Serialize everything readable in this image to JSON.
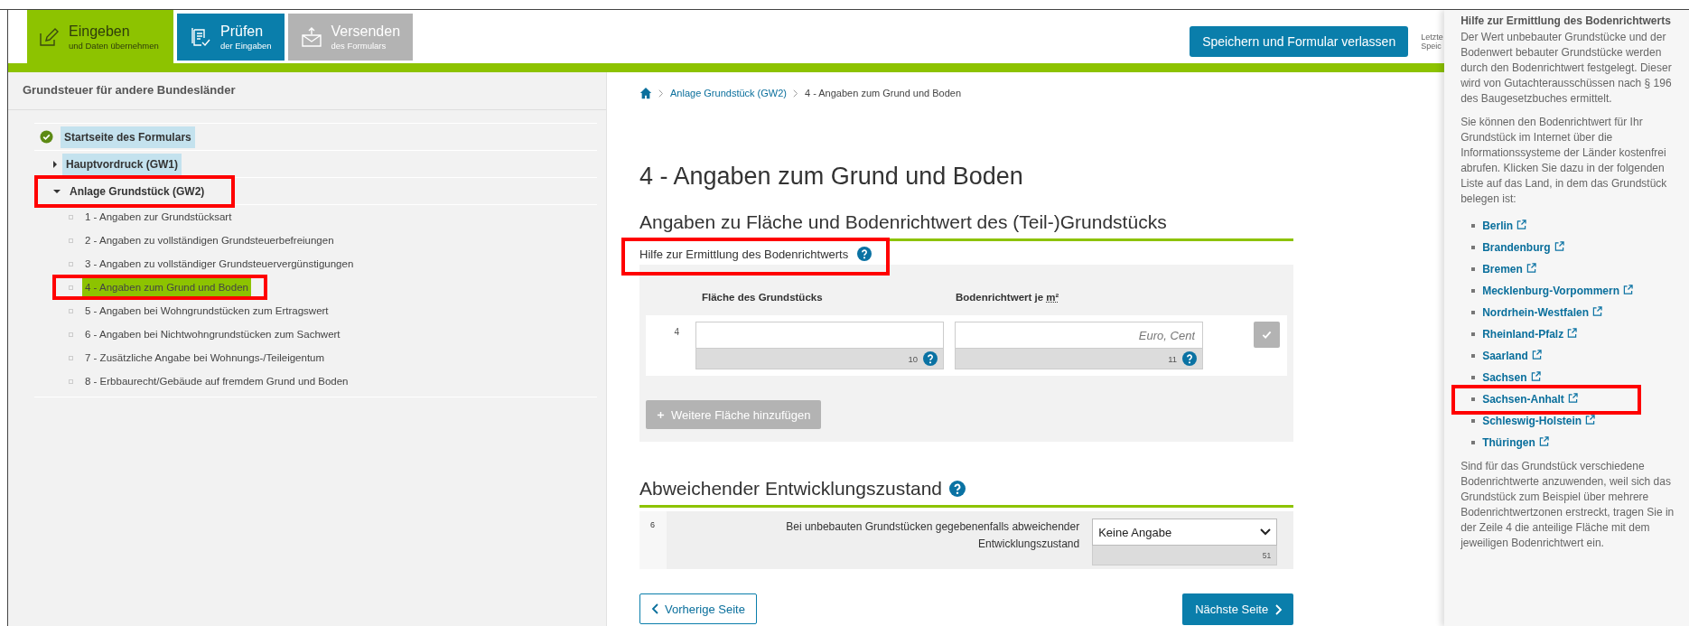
{
  "header": {
    "tabs": [
      {
        "title": "Eingeben",
        "subtitle": "und Daten übernehmen",
        "kind": "edit",
        "selected": true,
        "disabled": false
      },
      {
        "title": "Prüfen",
        "subtitle": "der Eingaben",
        "kind": "check",
        "selected": false,
        "disabled": false
      },
      {
        "title": "Versenden",
        "subtitle": "des Formulars",
        "kind": "send",
        "selected": false,
        "disabled": true
      }
    ],
    "save_button": "Speichern und Formular verlassen",
    "last_saved": [
      "Letzte",
      "Speic"
    ]
  },
  "sidebar": {
    "title": "Grundsteuer für andere Bundesländer",
    "tree": [
      {
        "label": "Startseite des Formulars",
        "kind": "done",
        "visited": true,
        "marked": false
      },
      {
        "label": "Hauptvordruck (GW1)",
        "kind": "group",
        "visited": true,
        "marked": false,
        "expanded": false
      },
      {
        "label": "Anlage Grundstück (GW2)",
        "kind": "group",
        "visited": false,
        "marked": true,
        "expanded": true,
        "children": [
          {
            "label": "1 - Angaben zur Grundstücksart",
            "selected": false,
            "marked": false
          },
          {
            "label": "2 - Angaben zu vollständigen Grundsteuerbefreiungen",
            "selected": false,
            "marked": false
          },
          {
            "label": "3 - Angaben zu vollständiger Grundsteuervergünstigungen",
            "selected": false,
            "marked": false
          },
          {
            "label": "4 - Angaben zum Grund und Boden",
            "selected": true,
            "marked": true
          },
          {
            "label": "5 - Angaben bei Wohngrundstücken zum Ertragswert",
            "selected": false,
            "marked": false
          },
          {
            "label": "6 - Angaben bei Nichtwohngrundstücken zum Sachwert",
            "selected": false,
            "marked": false
          },
          {
            "label": "7 - Zusätzliche Angabe bei Wohnungs-/Teileigentum",
            "selected": false,
            "marked": false
          },
          {
            "label": "8 - Erbbaurecht/Gebäude auf fremdem Grund und Boden",
            "selected": false,
            "marked": false
          }
        ]
      }
    ]
  },
  "breadcrumb": [
    "Anlage Grundstück (GW2)",
    "4 - Angaben zum Grund und Boden"
  ],
  "title": "4 - Angaben zum Grund und Boden",
  "area_section": {
    "heading": "Angaben zu Fläche und Bodenrichtwert des (Teil-)Grundstücks",
    "help": {
      "text": "Hilfe zur Ermittlung des Bodenrichtwerts",
      "marked": true
    },
    "columns": [
      {
        "label": "Fläche des Grundstücks"
      },
      {
        "label": "Bodenrichtwert je",
        "abbr": "m²"
      }
    ],
    "rows": [
      {
        "line": "4",
        "fields": [
          {
            "code": "10"
          },
          {
            "placeholder": "Euro, Cent",
            "code": "11"
          }
        ]
      }
    ],
    "add_button": "Weitere Fläche hinzufügen"
  },
  "state_section": {
    "heading": "Abweichender Entwicklungszustand",
    "line": "6",
    "label": "Bei unbebauten Grundstücken gegebenenfalls abweichender Entwicklungszustand",
    "select": {
      "value": "Keine Angabe",
      "code": "51"
    }
  },
  "nav": {
    "previous": "Vorherige Seite",
    "next": "Nächste Seite"
  },
  "help_panel": {
    "title": "Hilfe zur Ermittlung des Bodenrichtwerts",
    "paragraphs": [
      "Der Wert unbebauter Grundstücke und der Bodenwert bebauter Grundstücke werden durch den Bodenrichtwert festgelegt. Dieser wird von Gutachterausschüssen nach § 196 des Baugesetzbuches ermittelt.",
      "Sie können den Bodenrichtwert für Ihr Grundstück im Internet über die Informationssysteme der Länder kostenfrei abrufen. Klicken Sie dazu in der folgenden Liste auf das Land, in dem das Grundstück belegen ist:"
    ],
    "links": [
      {
        "label": "Berlin",
        "marked": false
      },
      {
        "label": "Brandenburg",
        "marked": false
      },
      {
        "label": "Bremen",
        "marked": false
      },
      {
        "label": "Mecklenburg-Vorpommern",
        "marked": false
      },
      {
        "label": "Nordrhein-Westfalen",
        "marked": false
      },
      {
        "label": "Rheinland-Pfalz",
        "marked": false
      },
      {
        "label": "Saarland",
        "marked": false
      },
      {
        "label": "Sachsen",
        "marked": false
      },
      {
        "label": "Sachsen-Anhalt",
        "marked": true
      },
      {
        "label": "Schleswig-Holstein",
        "marked": false
      },
      {
        "label": "Thüringen",
        "marked": false
      }
    ],
    "footer": "Sind für das Grundstück verschiedene Bodenrichtwerte anzuwenden, weil sich das Grundstück zum Beispiel über mehrere Bodenrichtwertzonen erstreckt, tragen Sie in der Zeile 4 die anteilige Fläche mit dem jeweiligen Bodenrichtwert ein."
  }
}
